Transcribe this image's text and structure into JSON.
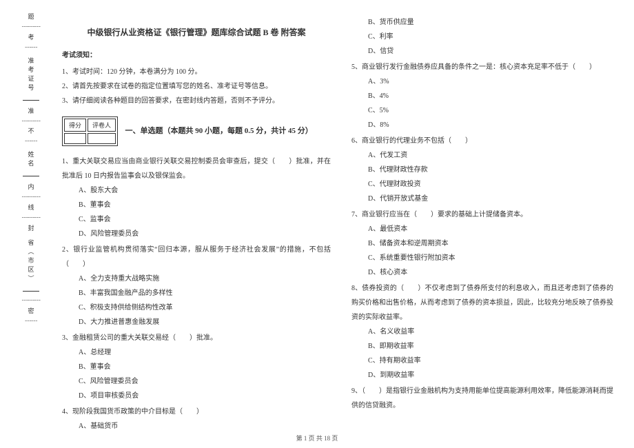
{
  "sidebar": {
    "province": "省（市区）",
    "seal": "封",
    "line_marker": "线",
    "name": "姓名",
    "inner": "内",
    "no_label": "不",
    "admit_no": "准考证号",
    "admit": "准",
    "exam_marker": "考",
    "bind": "题",
    "mi": "密"
  },
  "title": "中级银行从业资格证《银行管理》题库综合试题 B 卷  附答案",
  "notice_label": "考试须知：",
  "notices": [
    "1、考试时间：120 分钟，本卷满分为 100 分。",
    "2、请首先按要求在试卷的指定位置填写您的姓名、准考证号等信息。",
    "3、请仔细阅读各种题目的回答要求，在密封线内答题，否则不予评分。"
  ],
  "scorebox": {
    "score": "得分",
    "grader": "评卷人"
  },
  "section1_title": "一、单选题（本题共 90 小题，每题 0.5 分，共计 45 分）",
  "left_questions": [
    {
      "stem": "1、重大关联交易应当由商业银行关联交易控制委员会审查后，提交（　　）批准，并在批准后 10 日内报告监事会以及银保监会。",
      "opts": [
        "A、股东大会",
        "B、董事会",
        "C、监事会",
        "D、风险管理委员会"
      ]
    },
    {
      "stem": "2、银行业监管机构贯彻落实“回归本源，服从服务于经济社会发展”的措施，不包括（　　）",
      "opts": [
        "A、全力支持重大战略实施",
        "B、丰富我国金融产品的多样性",
        "C、积极支持供给侧结构性改革",
        "D、大力推进普惠金融发展"
      ]
    },
    {
      "stem": "3、金融租赁公司的重大关联交易经（　　）批准。",
      "opts": [
        "A、总经理",
        "B、董事会",
        "C、风险管理委员会",
        "D、项目审核委员会"
      ]
    },
    {
      "stem": "4、现阶段我国货币政策的中介目标是（　　）",
      "opts": [
        "A、基础货币"
      ]
    }
  ],
  "right_questions": [
    {
      "stem": "",
      "opts": [
        "B、货币供应量",
        "C、利率",
        "D、信贷"
      ]
    },
    {
      "stem": "5、商业银行发行金融债券应具备的条件之一是：核心资本充足率不低于（　　）",
      "opts": [
        "A、3%",
        "B、4%",
        "C、5%",
        "D、8%"
      ]
    },
    {
      "stem": "6、商业银行的代理业务不包括（　　）",
      "opts": [
        "A、代发工资",
        "B、代理财政性存款",
        "C、代理财政投资",
        "D、代销开放式基金"
      ]
    },
    {
      "stem": "7、商业银行应当在（　　）要求的基础上计提储备资本。",
      "opts": [
        "A、最低资本",
        "B、储备资本和逆周期资本",
        "C、系统重要性银行附加资本",
        "D、核心资本"
      ]
    },
    {
      "stem": "8、债券投资的（　　）不仅考虑到了债券所支付的利息收入，而且还考虑到了债券的购买价格和出售价格，从而考虑到了债券的资本损益，因此，比较充分地反映了债券投资的实际收益率。",
      "opts": [
        "A、名义收益率",
        "B、即期收益率",
        "C、持有期收益率",
        "D、到期收益率"
      ]
    },
    {
      "stem": "9、（　　）是指银行业金融机构为支持用能单位提高能源利用效率，降低能源消耗而提供的信贷融资。",
      "opts": []
    }
  ],
  "footer": "第 1 页  共 18 页"
}
